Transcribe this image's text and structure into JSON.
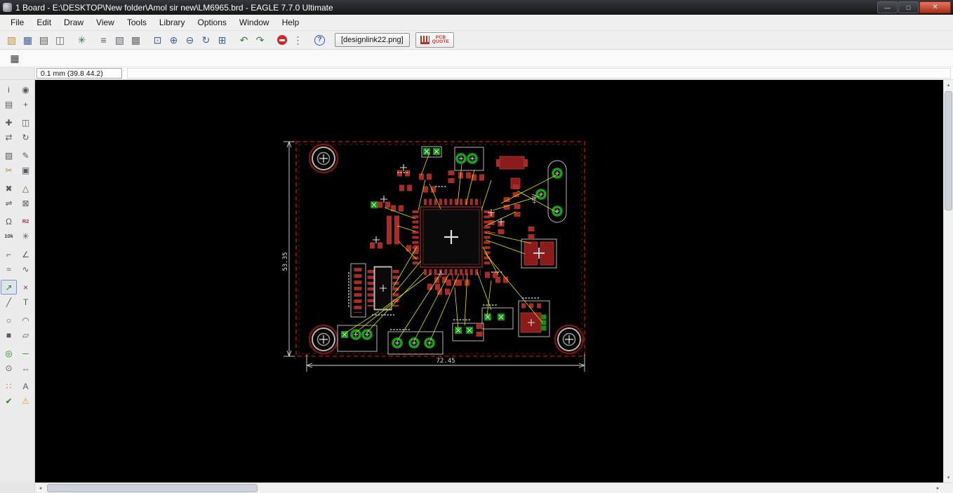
{
  "window": {
    "title": "1 Board - E:\\DESKTOP\\New folder\\Amol sir new\\LM6965.brd - EAGLE 7.7.0 Ultimate",
    "minimize_glyph": "—",
    "maximize_glyph": "□",
    "close_glyph": "✕"
  },
  "menubar": {
    "items": [
      "File",
      "Edit",
      "Draw",
      "View",
      "Tools",
      "Library",
      "Options",
      "Window",
      "Help"
    ]
  },
  "toolbar": {
    "icons": [
      {
        "name": "open",
        "glyph": "▨",
        "color": "#c89235"
      },
      {
        "name": "save",
        "glyph": "▦",
        "color": "#3b5fa0"
      },
      {
        "name": "print",
        "glyph": "▤",
        "color": "#55595e"
      },
      {
        "name": "cam-processor",
        "glyph": "◫",
        "color": "#666a6f"
      },
      {
        "sep": true
      },
      {
        "name": "run-ulp",
        "glyph": "✳",
        "color": "#2f7d46"
      },
      {
        "sep": true
      },
      {
        "name": "use-library",
        "glyph": "≡",
        "color": "#55595e"
      },
      {
        "name": "layer-settings",
        "glyph": "▧",
        "color": "#666a6f"
      },
      {
        "name": "select-layer",
        "glyph": "▩",
        "color": "#666a6f"
      },
      {
        "sep": true
      },
      {
        "name": "zoom-fit",
        "glyph": "⊡",
        "color": "#3b5fa0"
      },
      {
        "name": "zoom-in",
        "glyph": "⊕",
        "color": "#3b5fa0"
      },
      {
        "name": "zoom-out",
        "glyph": "⊖",
        "color": "#3b5fa0"
      },
      {
        "name": "zoom-redraw",
        "glyph": "↻",
        "color": "#3b5fa0"
      },
      {
        "name": "zoom-select",
        "glyph": "⊞",
        "color": "#3b5fa0"
      },
      {
        "sep": true
      },
      {
        "name": "undo",
        "glyph": "↶",
        "color": "#2f7d46"
      },
      {
        "name": "redo",
        "glyph": "↷",
        "color": "#2f7d46"
      },
      {
        "sep": true
      },
      {
        "name": "stop",
        "shape": "stop"
      },
      {
        "name": "more",
        "glyph": "⋮",
        "color": "#55595e"
      },
      {
        "sep": true
      },
      {
        "name": "help",
        "glyph": "?",
        "shape": "help"
      }
    ],
    "designlink_label": "[designlink22.png]",
    "pcb_quote": {
      "line1": "PCB",
      "line2": "QUOTE"
    }
  },
  "param_toolbar": {
    "grid_glyph": "▦"
  },
  "coordinate_bar": {
    "position": "0.1 mm (39.8 44.2)",
    "command_value": ""
  },
  "tool_palette": {
    "tools": [
      {
        "name": "info",
        "glyph": "i"
      },
      {
        "name": "show",
        "glyph": "◉"
      },
      {
        "name": "display",
        "glyph": "▤"
      },
      {
        "name": "mark",
        "glyph": "+"
      },
      {
        "sep": true
      },
      {
        "name": "move",
        "glyph": "✚"
      },
      {
        "name": "copy",
        "glyph": "◫"
      },
      {
        "name": "mirror",
        "glyph": "⇄"
      },
      {
        "name": "rotate",
        "glyph": "↻"
      },
      {
        "sep": true
      },
      {
        "name": "group",
        "glyph": "▧"
      },
      {
        "name": "change",
        "glyph": "✎"
      },
      {
        "name": "cut",
        "glyph": "✂",
        "color": "#b08a1e"
      },
      {
        "name": "paste",
        "glyph": "▣"
      },
      {
        "sep": true
      },
      {
        "name": "delete",
        "glyph": "✖"
      },
      {
        "name": "add",
        "glyph": "△"
      },
      {
        "name": "pinswap",
        "glyph": "⇌"
      },
      {
        "name": "replace",
        "glyph": "⊠"
      },
      {
        "sep": true
      },
      {
        "name": "lock",
        "glyph": "Ω"
      },
      {
        "name": "name",
        "glyph": "R2",
        "small": true,
        "color": "#a33535"
      },
      {
        "name": "value",
        "glyph": "10k",
        "small": true,
        "color": "#444444"
      },
      {
        "name": "smash",
        "glyph": "✳"
      },
      {
        "sep": true
      },
      {
        "name": "miter",
        "glyph": "⌐"
      },
      {
        "name": "split",
        "glyph": "∠"
      },
      {
        "name": "optimize",
        "glyph": "≈"
      },
      {
        "name": "meander",
        "glyph": "∿"
      },
      {
        "sep": true
      },
      {
        "name": "route",
        "glyph": "↗",
        "selected": true,
        "color": "#1a8c1a"
      },
      {
        "name": "ripup",
        "glyph": "×",
        "color": "#b03030"
      },
      {
        "name": "wire",
        "glyph": "╱"
      },
      {
        "name": "text",
        "glyph": "T"
      },
      {
        "sep": true
      },
      {
        "name": "circle",
        "glyph": "○"
      },
      {
        "name": "arc",
        "glyph": "◠"
      },
      {
        "name": "rect",
        "glyph": "■"
      },
      {
        "name": "polygon",
        "glyph": "▱"
      },
      {
        "sep": true
      },
      {
        "name": "via",
        "glyph": "◎",
        "color": "#1a8c1a"
      },
      {
        "name": "signal",
        "glyph": "─",
        "color": "#1a8c1a"
      },
      {
        "name": "hole",
        "glyph": "⊙"
      },
      {
        "name": "dimension",
        "glyph": "↔"
      },
      {
        "sep": true
      },
      {
        "name": "ratsnest",
        "glyph": "∷",
        "color": "#c87818"
      },
      {
        "name": "auto",
        "glyph": "A"
      },
      {
        "name": "drc",
        "glyph": "✔",
        "color": "#1a8c1a"
      },
      {
        "name": "errors",
        "glyph": "⚠",
        "color": "#e2a51c"
      }
    ]
  },
  "canvas": {
    "dim_width_label": "72.45",
    "dim_height_label": "53.35",
    "battery_label": "+9V",
    "colors": {
      "copper": "#a62c25",
      "pad_green": "#17a317",
      "airwire": "#e6e600",
      "board_outline": "#c41414",
      "silkscreen": "#c8c8c8",
      "dimension": "#d9d9d9",
      "background": "#000000"
    }
  },
  "scrollbars": {
    "up": "▴",
    "down": "▾",
    "left": "◂",
    "right": "▸"
  }
}
